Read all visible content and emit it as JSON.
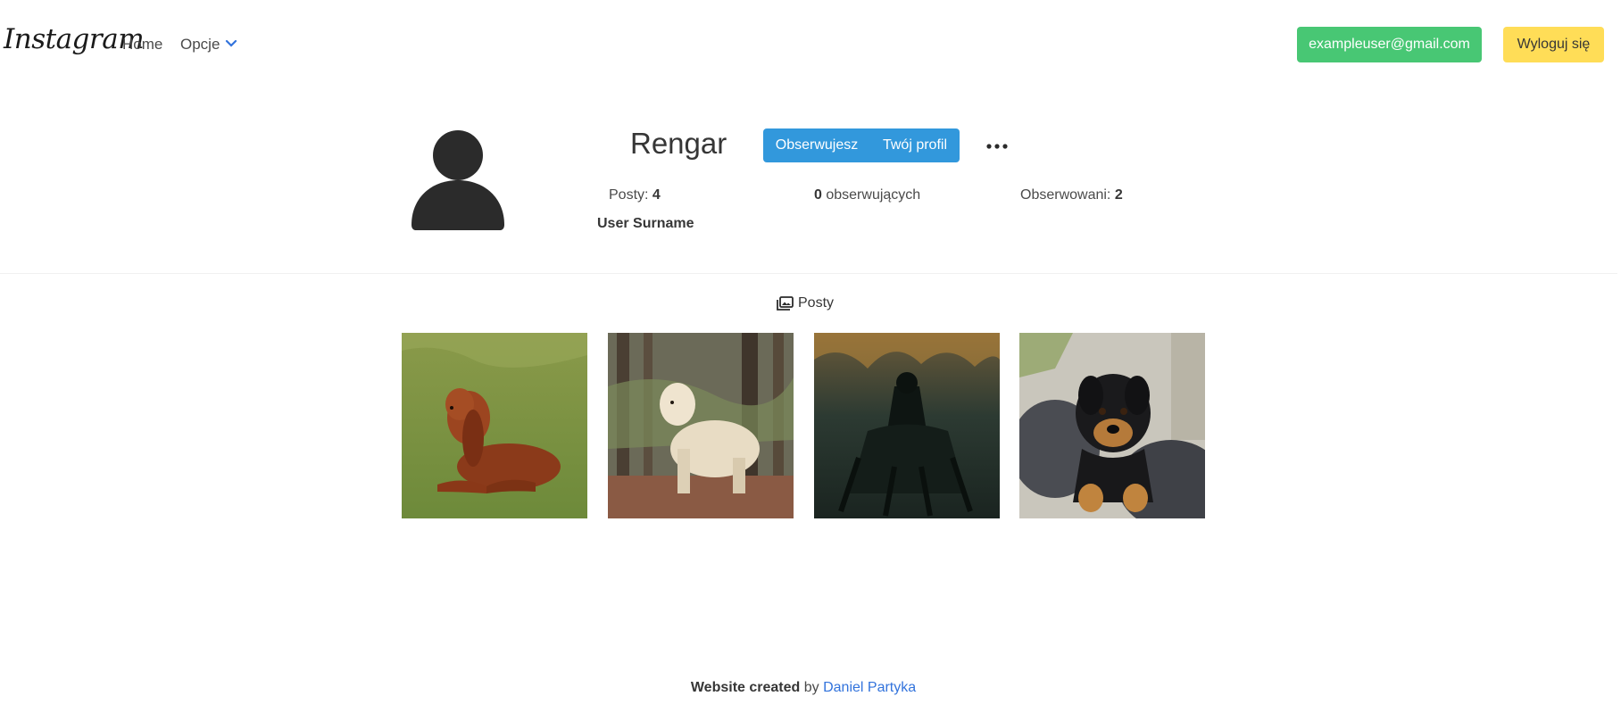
{
  "navbar": {
    "brand": "Instagram",
    "home_label": "Home",
    "options_label": "Opcje",
    "email_label": "exampleuser@gmail.com",
    "logout_label": "Wyloguj się"
  },
  "profile": {
    "username": "Rengar",
    "follow_label": "Obserwujesz",
    "your_profile_label": "Twój profil",
    "posts_label": "Posty:",
    "posts_count": "4",
    "followers_count": "0",
    "followers_label": "obserwujących",
    "following_label": "Obserwowani:",
    "following_count": "2",
    "full_name": "User Surname"
  },
  "tabs": {
    "posts_label": "Posty"
  },
  "posts": [
    {
      "subject": "red cocker spaniel on grass"
    },
    {
      "subject": "golden retriever in forest"
    },
    {
      "subject": "dark hooded rider on horse"
    },
    {
      "subject": "black and tan puppy"
    }
  ],
  "footer": {
    "created_label": "Website created",
    "by_label": "by",
    "author_link": "Daniel Partyka"
  },
  "colors": {
    "success": "#48c774",
    "warning": "#ffdd57",
    "info": "#3298dc",
    "link": "#3273dc"
  }
}
